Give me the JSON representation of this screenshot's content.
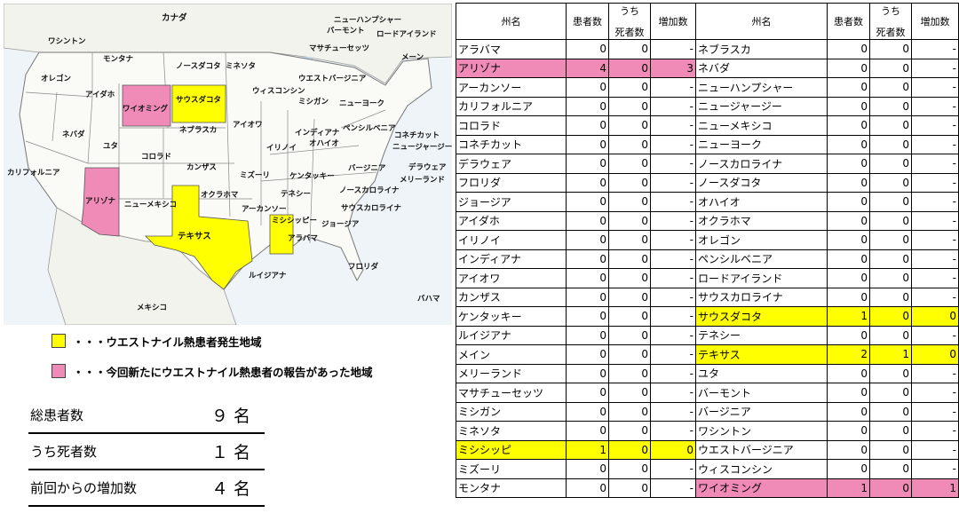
{
  "map": {
    "labels": [
      "カナダ",
      "ワシントン",
      "モンタナ",
      "ノースダコタ",
      "ミネソタ",
      "オレゴン",
      "アイダホ",
      "ワイオミング",
      "サウスダコタ",
      "ウィスコンシン",
      "ミシガン",
      "ネバダ",
      "ユタ",
      "コロラド",
      "ネブラスカ",
      "アイオワ",
      "イリノイ",
      "インディアナ",
      "オハイオ",
      "カリフォルニア",
      "アリゾナ",
      "ニューメキシコ",
      "カンザス",
      "ミズーリ",
      "ケンタッキー",
      "オクラホマ",
      "テネシー",
      "アーカンソー",
      "ミシシッピー",
      "アラバマ",
      "ジョージア",
      "テキサス",
      "ルイジアナ",
      "フロリダ",
      "メキシコ",
      "バハマ",
      "ニューハンプシャー",
      "バーモント",
      "マサチューセッツ",
      "ロードアイランド",
      "メーン",
      "ウエストバージニア",
      "ニューヨーク",
      "ペンシルベニア",
      "コネチカット",
      "ニュージャージー",
      "バージニア",
      "デラウェア",
      "メリーランド",
      "ノースカロライナ",
      "サウスカロライナ"
    ],
    "colors": {
      "yellow": "#ffff00",
      "pink": "#f08bb8"
    }
  },
  "legend": [
    {
      "color": "#ffff00",
      "text": "・・・ウエストナイル熱患者発生地域"
    },
    {
      "color": "#f08bb8",
      "text": "・・・今回新たにウエストナイル熱患者の報告があった地域"
    }
  ],
  "summary": [
    {
      "label": "総患者数",
      "value": "９ 名"
    },
    {
      "label": "うち死者数",
      "value": "１ 名"
    },
    {
      "label": "前回からの増加数",
      "value": "４ 名"
    }
  ],
  "table": {
    "headers": {
      "state": "州名",
      "patients": "患者数",
      "deaths_top": "うち",
      "deaths_bottom": "死者数",
      "increase": "増加数"
    },
    "rows": [
      {
        "l": [
          "アラバマ",
          "0",
          "0",
          "-"
        ],
        "lh": "",
        "r": [
          "ネブラスカ",
          "0",
          "0",
          "-"
        ],
        "rh": ""
      },
      {
        "l": [
          "アリゾナ",
          "4",
          "0",
          "3"
        ],
        "lh": "pink",
        "r": [
          "ネバダ",
          "0",
          "0",
          "-"
        ],
        "rh": ""
      },
      {
        "l": [
          "アーカンソー",
          "0",
          "0",
          "-"
        ],
        "lh": "",
        "r": [
          "ニューハンプシャー",
          "0",
          "0",
          "-"
        ],
        "rh": ""
      },
      {
        "l": [
          "カリフォルニア",
          "0",
          "0",
          "-"
        ],
        "lh": "",
        "r": [
          "ニュージャージー",
          "0",
          "0",
          "-"
        ],
        "rh": ""
      },
      {
        "l": [
          "コロラド",
          "0",
          "0",
          "-"
        ],
        "lh": "",
        "r": [
          "ニューメキシコ",
          "0",
          "0",
          "-"
        ],
        "rh": ""
      },
      {
        "l": [
          "コネチカット",
          "0",
          "0",
          "-"
        ],
        "lh": "",
        "r": [
          "ニューヨーク",
          "0",
          "0",
          "-"
        ],
        "rh": ""
      },
      {
        "l": [
          "デラウェア",
          "0",
          "0",
          "-"
        ],
        "lh": "",
        "r": [
          "ノースカロライナ",
          "0",
          "0",
          "-"
        ],
        "rh": ""
      },
      {
        "l": [
          "フロリダ",
          "0",
          "0",
          "-"
        ],
        "lh": "",
        "r": [
          "ノースダコタ",
          "0",
          "0",
          "-"
        ],
        "rh": ""
      },
      {
        "l": [
          "ジョージア",
          "0",
          "0",
          "-"
        ],
        "lh": "",
        "r": [
          "オハイオ",
          "0",
          "0",
          "-"
        ],
        "rh": ""
      },
      {
        "l": [
          "アイダホ",
          "0",
          "0",
          "-"
        ],
        "lh": "",
        "r": [
          "オクラホマ",
          "0",
          "0",
          "-"
        ],
        "rh": ""
      },
      {
        "l": [
          "イリノイ",
          "0",
          "0",
          "-"
        ],
        "lh": "",
        "r": [
          "オレゴン",
          "0",
          "0",
          "-"
        ],
        "rh": ""
      },
      {
        "l": [
          "インディアナ",
          "0",
          "0",
          "-"
        ],
        "lh": "",
        "r": [
          "ペンシルベニア",
          "0",
          "0",
          "-"
        ],
        "rh": ""
      },
      {
        "l": [
          "アイオワ",
          "0",
          "0",
          "-"
        ],
        "lh": "",
        "r": [
          "ロードアイランド",
          "0",
          "0",
          "-"
        ],
        "rh": ""
      },
      {
        "l": [
          "カンザス",
          "0",
          "0",
          "-"
        ],
        "lh": "",
        "r": [
          "サウスカロライナ",
          "0",
          "0",
          "-"
        ],
        "rh": ""
      },
      {
        "l": [
          "ケンタッキー",
          "0",
          "0",
          "-"
        ],
        "lh": "",
        "r": [
          "サウスダコタ",
          "1",
          "0",
          "0"
        ],
        "rh": "yellow"
      },
      {
        "l": [
          "ルイジアナ",
          "0",
          "0",
          "-"
        ],
        "lh": "",
        "r": [
          "テネシー",
          "0",
          "0",
          "-"
        ],
        "rh": ""
      },
      {
        "l": [
          "メイン",
          "0",
          "0",
          "-"
        ],
        "lh": "",
        "r": [
          "テキサス",
          "2",
          "1",
          "0"
        ],
        "rh": "yellow"
      },
      {
        "l": [
          "メリーランド",
          "0",
          "0",
          "-"
        ],
        "lh": "",
        "r": [
          "ユタ",
          "0",
          "0",
          "-"
        ],
        "rh": ""
      },
      {
        "l": [
          "マサチューセッツ",
          "0",
          "0",
          "-"
        ],
        "lh": "",
        "r": [
          "バーモント",
          "0",
          "0",
          "-"
        ],
        "rh": ""
      },
      {
        "l": [
          "ミシガン",
          "0",
          "0",
          "-"
        ],
        "lh": "",
        "r": [
          "バージニア",
          "0",
          "0",
          "-"
        ],
        "rh": ""
      },
      {
        "l": [
          "ミネソタ",
          "0",
          "0",
          "-"
        ],
        "lh": "",
        "r": [
          "ワシントン",
          "0",
          "0",
          "-"
        ],
        "rh": ""
      },
      {
        "l": [
          "ミシシッピ",
          "1",
          "0",
          "0"
        ],
        "lh": "yellow",
        "r": [
          "ウエストバージニア",
          "0",
          "0",
          "-"
        ],
        "rh": ""
      },
      {
        "l": [
          "ミズーリ",
          "0",
          "0",
          "-"
        ],
        "lh": "",
        "r": [
          "ウィスコンシン",
          "0",
          "0",
          "-"
        ],
        "rh": ""
      },
      {
        "l": [
          "モンタナ",
          "0",
          "0",
          "-"
        ],
        "lh": "",
        "r": [
          "ワイオミング",
          "1",
          "0",
          "1"
        ],
        "rh": "pink"
      }
    ]
  }
}
